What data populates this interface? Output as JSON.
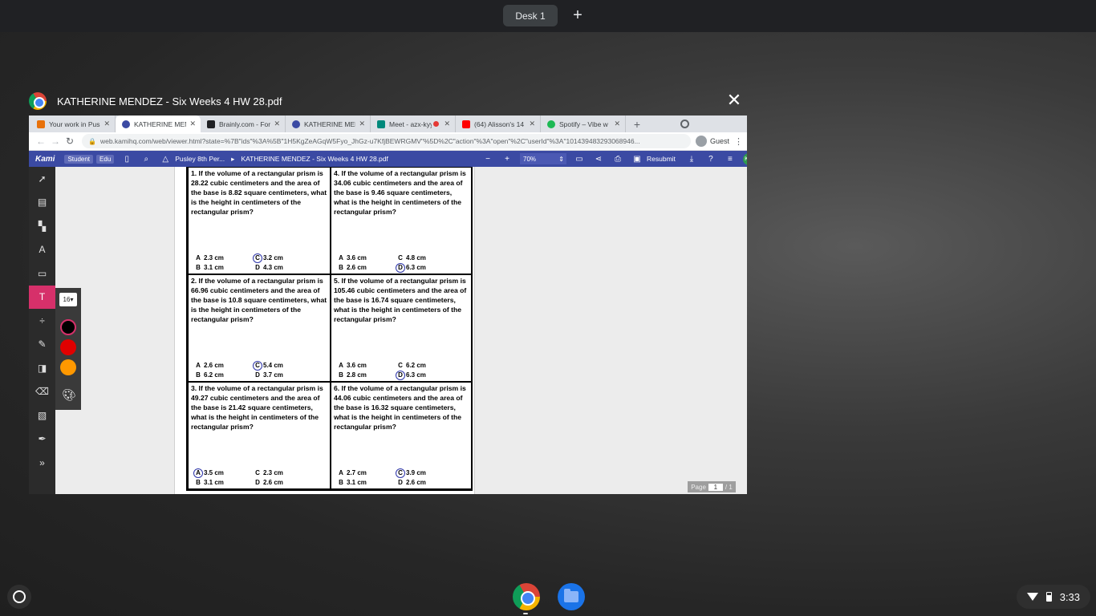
{
  "desk": {
    "label": "Desk 1",
    "add": "+"
  },
  "window": {
    "title": "KATHERINE MENDEZ - Six Weeks 4 HW 28.pdf",
    "close": "✕"
  },
  "tabs": [
    {
      "label": "Your work in Pus",
      "color": "#e8710a"
    },
    {
      "label": "KATHERINE MEN",
      "color": "#3b4aa3",
      "active": true
    },
    {
      "label": "Brainly.com - For",
      "color": "#202124"
    },
    {
      "label": "KATHERINE MEN",
      "color": "#3b4aa3"
    },
    {
      "label": "Meet - azx-kyy",
      "color": "#00897b"
    },
    {
      "label": "(64) Alisson's 14",
      "color": "#ff0000"
    },
    {
      "label": "Spotify – Vibe w",
      "color": "#1db954"
    }
  ],
  "new_tab": "+",
  "omnibox": {
    "url": "web.kamihq.com/web/viewer.html?state=%7B\"ids\"%3A%5B\"1H5KgZeAGqW5Fyo_JhGz-u7KfjBEWRGMV\"%5D%2C\"action\"%3A\"open\"%2C\"userId\"%3A\"101439483293068946...",
    "guest": "Guest"
  },
  "kami": {
    "logo": "Kami",
    "tags": [
      "Student",
      "Edu"
    ],
    "breadcrumb_folder": "Pusley 8th Per...",
    "breadcrumb_file": "KATHERINE MENDEZ - Six Weeks 4 HW 28.pdf",
    "zoom": "70%",
    "resubmit": "Resubmit",
    "avatar": "KM"
  },
  "tool_popout": {
    "font_size": "16",
    "colors": [
      "#000000",
      "#e00000",
      "#ff9800"
    ]
  },
  "questions": [
    {
      "text": "1. If the volume of a rectangular prism is 28.22 cubic centimeters and the area of the base is 8.82 square centimeters, what is the height in centimeters of the rectangular prism?",
      "answers": [
        {
          "letter": "A",
          "value": "2.3 cm",
          "circled": false
        },
        {
          "letter": "C",
          "value": "3.2 cm",
          "circled": true
        },
        {
          "letter": "B",
          "value": "3.1 cm",
          "circled": false
        },
        {
          "letter": "D",
          "value": "4.3 cm",
          "circled": false
        }
      ]
    },
    {
      "text": "4.  If the volume of a rectangular prism is 34.06 cubic centimeters and the area of the base is 9.46 square centimeters, what is the height in centimeters of the rectangular prism?",
      "answers": [
        {
          "letter": "A",
          "value": "3.6 cm",
          "circled": false
        },
        {
          "letter": "C",
          "value": "4.8 cm",
          "circled": false
        },
        {
          "letter": "B",
          "value": "2.6 cm",
          "circled": false
        },
        {
          "letter": "D",
          "value": "6.3 cm",
          "circled": true
        }
      ]
    },
    {
      "text": "2. If the volume of a rectangular prism is 66.96 cubic centimeters and the area of the base is 10.8 square centimeters, what is the height in centimeters of the rectangular prism?",
      "answers": [
        {
          "letter": "A",
          "value": "2.6 cm",
          "circled": false
        },
        {
          "letter": "C",
          "value": "5.4 cm",
          "circled": true
        },
        {
          "letter": "B",
          "value": "6.2 cm",
          "circled": false
        },
        {
          "letter": "D",
          "value": "3.7 cm",
          "circled": false
        }
      ]
    },
    {
      "text": "5.  If the volume of a rectangular prism is 105.46 cubic centimeters and the area of the base is 16.74 square centimeters, what is the height in centimeters of the rectangular prism?",
      "answers": [
        {
          "letter": "A",
          "value": "3.6 cm",
          "circled": false
        },
        {
          "letter": "C",
          "value": "6.2 cm",
          "circled": false
        },
        {
          "letter": "B",
          "value": "2.8 cm",
          "circled": false
        },
        {
          "letter": "D",
          "value": "6.3 cm",
          "circled": true
        }
      ]
    },
    {
      "text": "3. If the volume of a rectangular prism is 49.27 cubic centimeters and the area of the base is 21.42 square centimeters, what is the height in centimeters of the rectangular prism?",
      "answers": [
        {
          "letter": "A",
          "value": "3.5 cm",
          "circled": true
        },
        {
          "letter": "C",
          "value": "2.3 cm",
          "circled": false
        },
        {
          "letter": "B",
          "value": "3.1 cm",
          "circled": false
        },
        {
          "letter": "D",
          "value": "2.6 cm",
          "circled": false
        }
      ]
    },
    {
      "text": "6. If the volume of a rectangular prism is 44.06 cubic centimeters and the area of the base is 16.32 square centimeters, what is the height in centimeters of the rectangular prism?",
      "answers": [
        {
          "letter": "A",
          "value": "2.7 cm",
          "circled": false
        },
        {
          "letter": "C",
          "value": "3.9 cm",
          "circled": true
        },
        {
          "letter": "B",
          "value": "3.1 cm",
          "circled": false
        },
        {
          "letter": "D",
          "value": "2.6 cm",
          "circled": false
        }
      ]
    }
  ],
  "page_indicator": {
    "label": "Page",
    "current": "1",
    "total": "/ 1"
  },
  "shelf": {
    "time": "3:33"
  }
}
